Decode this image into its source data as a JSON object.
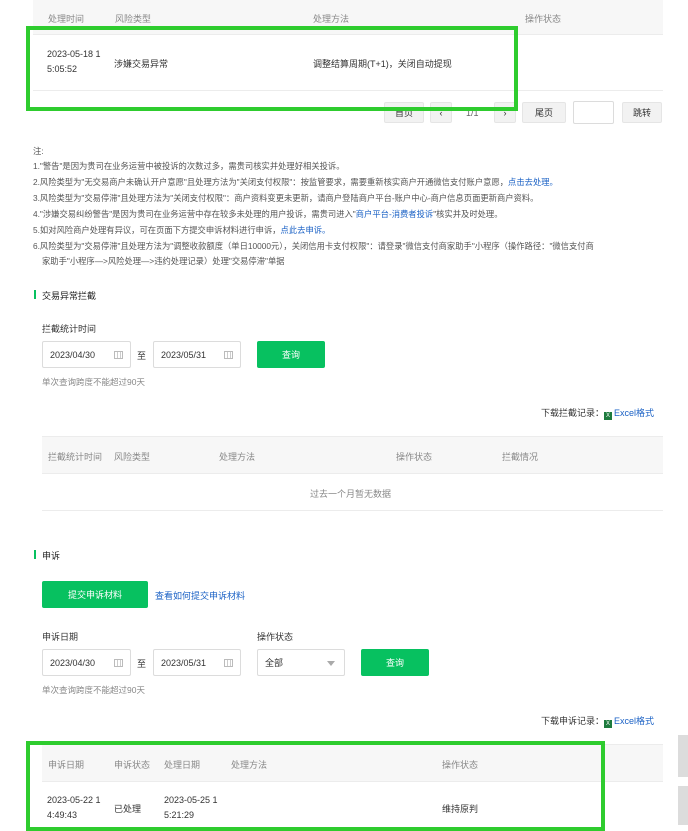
{
  "top_table": {
    "headers": [
      "处理时间",
      "风险类型",
      "处理方法",
      "操作状态"
    ],
    "row": {
      "time_line1": "2023-05-18 1",
      "time_line2": "5:05:52",
      "risk_type": "涉嫌交易异常",
      "method": "调整结算周期(T+1)，关闭自动提现",
      "status": ""
    }
  },
  "pagination": {
    "first": "首页",
    "prev": "‹",
    "page": "1/1",
    "next": "›",
    "last": "尾页",
    "jump": "跳转",
    "jump_value": ""
  },
  "notes": {
    "title": "注:",
    "lines": [
      {
        "text": "1.\"警告\"是因为贵司在业务运营中被投诉的次数过多，需贵司核实并处理好相关投诉。",
        "link": "",
        "tail": ""
      },
      {
        "text": "2.风险类型为\"无交易商户未确认开户意愿\"且处理方法为\"关闭支付权限\"：按监管要求，需要重新核实商户开通微信支付账户意愿，",
        "link": "点击去处理。",
        "tail": ""
      },
      {
        "text": "3.风险类型为\"交易停滞\"且处理方法为\"关闭支付权限\"：商户资料变更未更新，请商户登陆商户平台-账户中心-商户信息页面更新商户资料。",
        "link": "",
        "tail": ""
      },
      {
        "text": "4.\"涉嫌交易纠纷警告\"是因为贵司在业务运营中存在较多未处理的用户投诉，需贵司进入\"",
        "link": "商户平台-消费者投诉",
        "tail": "\"核实并及时处理。"
      },
      {
        "text": "5.如对风险商户处理有异议，可在页面下方提交申诉材料进行申诉，",
        "link": "点此去申诉。",
        "tail": ""
      },
      {
        "text": "6.风险类型为\"交易停滞\"且处理方法为\"调整收款额度（单日10000元），关闭信用卡支付权限\"：请登录\"微信支付商家助手\"小程序（操作路径：\"微信支付商",
        "link": "",
        "tail": ""
      },
      {
        "text": "家助手\"小程序—>风险处理—>违约处理记录）处理\"交易停滞\"单据",
        "link": "",
        "tail": ""
      }
    ]
  },
  "intercept": {
    "section_title": "交易异常拦截",
    "time_label": "拦截统计时间",
    "start_date": "2023/04/30",
    "to": "至",
    "end_date": "2023/05/31",
    "query": "查询",
    "hint": "单次查询跨度不能超过90天",
    "download_label": "下载拦截记录：",
    "excel": "Excel格式",
    "headers": [
      "拦截统计时间",
      "风险类型",
      "处理方法",
      "操作状态",
      "拦截情况"
    ],
    "empty": "过去一个月暂无数据"
  },
  "appeal": {
    "section_title": "申诉",
    "submit": "提交申诉材料",
    "how_link": "查看如何提交申诉材料",
    "date_label": "申诉日期",
    "status_label": "操作状态",
    "start_date": "2023/04/30",
    "to": "至",
    "end_date": "2023/05/31",
    "status_value": "全部",
    "query": "查询",
    "hint": "单次查询跨度不能超过90天",
    "download_label": "下载申诉记录：",
    "excel": "Excel格式",
    "headers": [
      "申诉日期",
      "申诉状态",
      "处理日期",
      "处理方法",
      "操作状态"
    ],
    "row": {
      "date_line1": "2023-05-22 1",
      "date_line2": "4:49:43",
      "appeal_status": "已处理",
      "proc_line1": "2023-05-25 1",
      "proc_line2": "5:21:29",
      "method": "",
      "status": "维持原判"
    }
  },
  "colors": {
    "accent": "#07c160",
    "highlight": "#2ecc2e",
    "link": "#1a61c5"
  }
}
